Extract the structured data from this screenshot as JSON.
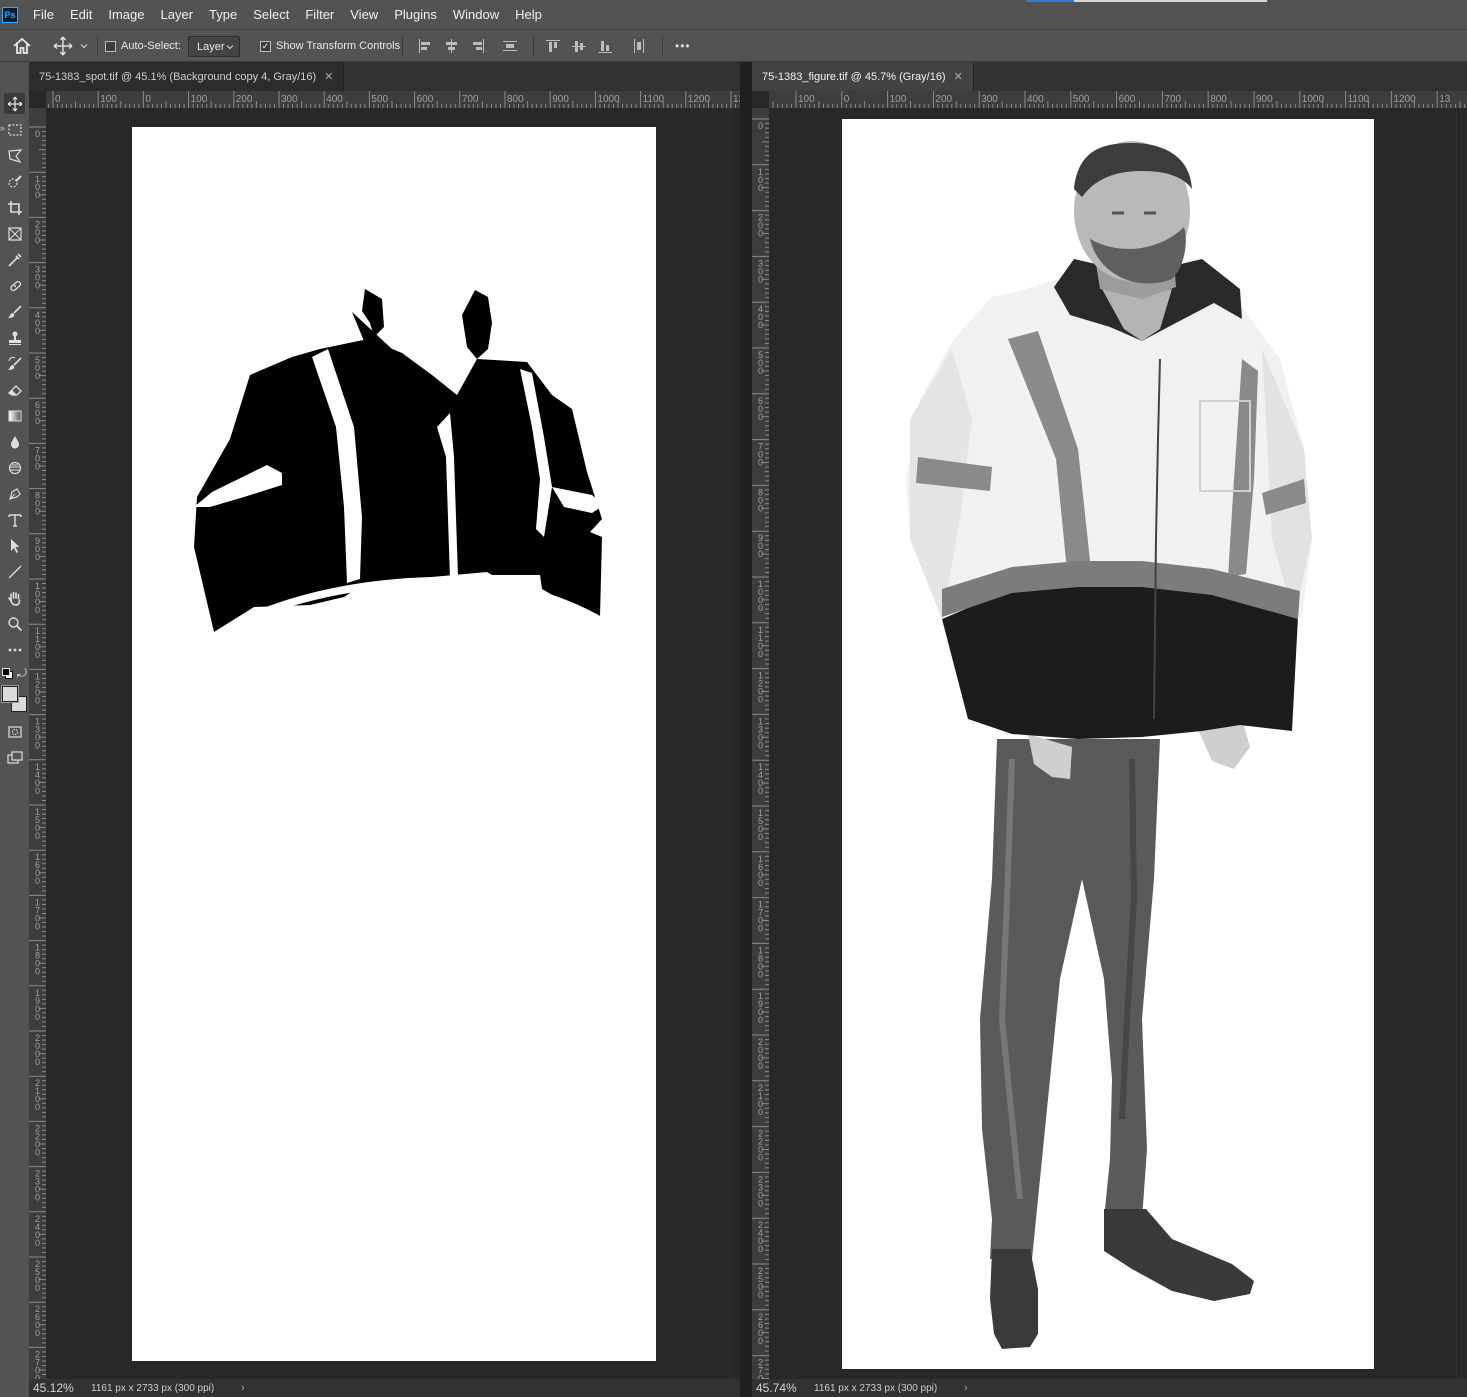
{
  "app": {
    "logo_text": "Ps",
    "menu": [
      "File",
      "Edit",
      "Image",
      "Layer",
      "Type",
      "Select",
      "Filter",
      "View",
      "Plugins",
      "Window",
      "Help"
    ]
  },
  "options_bar": {
    "auto_select_label": "Auto-Select:",
    "auto_select_checked": false,
    "target_dropdown": "Layer",
    "show_transform_label": "Show Transform Controls",
    "show_transform_checked": true,
    "more_label": "•••"
  },
  "toolbar": {
    "tools": [
      "move-tool",
      "rectangular-marquee-tool",
      "polygonal-lasso-tool",
      "quick-selection-tool",
      "crop-tool",
      "frame-tool",
      "eyedropper-tool",
      "spot-healing-brush-tool",
      "brush-tool",
      "clone-stamp-tool",
      "history-brush-tool",
      "eraser-tool",
      "gradient-tool",
      "blur-tool",
      "dodge-tool",
      "pen-tool",
      "type-tool",
      "path-selection-tool",
      "line-tool",
      "hand-tool",
      "zoom-tool",
      "edit-toolbar"
    ],
    "foreground_color": "#d9d9d9",
    "background_color": "#d9d9d9"
  },
  "documents": [
    {
      "tab_title": "75-1383_spot.tif @ 45.1% (Background copy 4, Gray/16)",
      "active": false,
      "ruler_h": [
        "0",
        "100",
        "0",
        "100",
        "200",
        "300",
        "400",
        "500",
        "600",
        "700",
        "800",
        "900",
        "1000",
        "1100",
        "1200",
        "130"
      ],
      "ruler_v": [
        "0",
        "100",
        "200",
        "300",
        "400",
        "500",
        "600",
        "700",
        "800",
        "900",
        "1000",
        "1100",
        "1200",
        "1300",
        "1400",
        "1500",
        "1600",
        "1700",
        "1800",
        "1900",
        "2000",
        "2100",
        "2200",
        "2300",
        "2400",
        "2500",
        "2600",
        "2700"
      ],
      "zoom": "45.12%",
      "dimensions": "1161 px x 2733 px (300 ppi)",
      "content": "black-silhouette-mask-of-jacket"
    },
    {
      "tab_title": "75-1383_figure.tif @ 45.7% (Gray/16)",
      "active": true,
      "ruler_h": [
        "100",
        "0",
        "100",
        "200",
        "300",
        "400",
        "500",
        "600",
        "700",
        "800",
        "900",
        "1000",
        "1100",
        "1200",
        "13"
      ],
      "ruler_v": [
        "0",
        "100",
        "200",
        "300",
        "400",
        "500",
        "600",
        "700",
        "800",
        "900",
        "1000",
        "1100",
        "1200",
        "1300",
        "1400",
        "1500",
        "1600",
        "1700",
        "1800",
        "1900",
        "2000",
        "2100",
        "2200",
        "2300",
        "2400",
        "2500",
        "2600",
        "2700"
      ],
      "zoom": "45.74%",
      "dimensions": "1161 px x 2733 px (300 ppi)",
      "content": "grayscale-photo-man-in-safety-jacket"
    }
  ],
  "status_more_glyph": "›",
  "collapse_glyph": "»"
}
